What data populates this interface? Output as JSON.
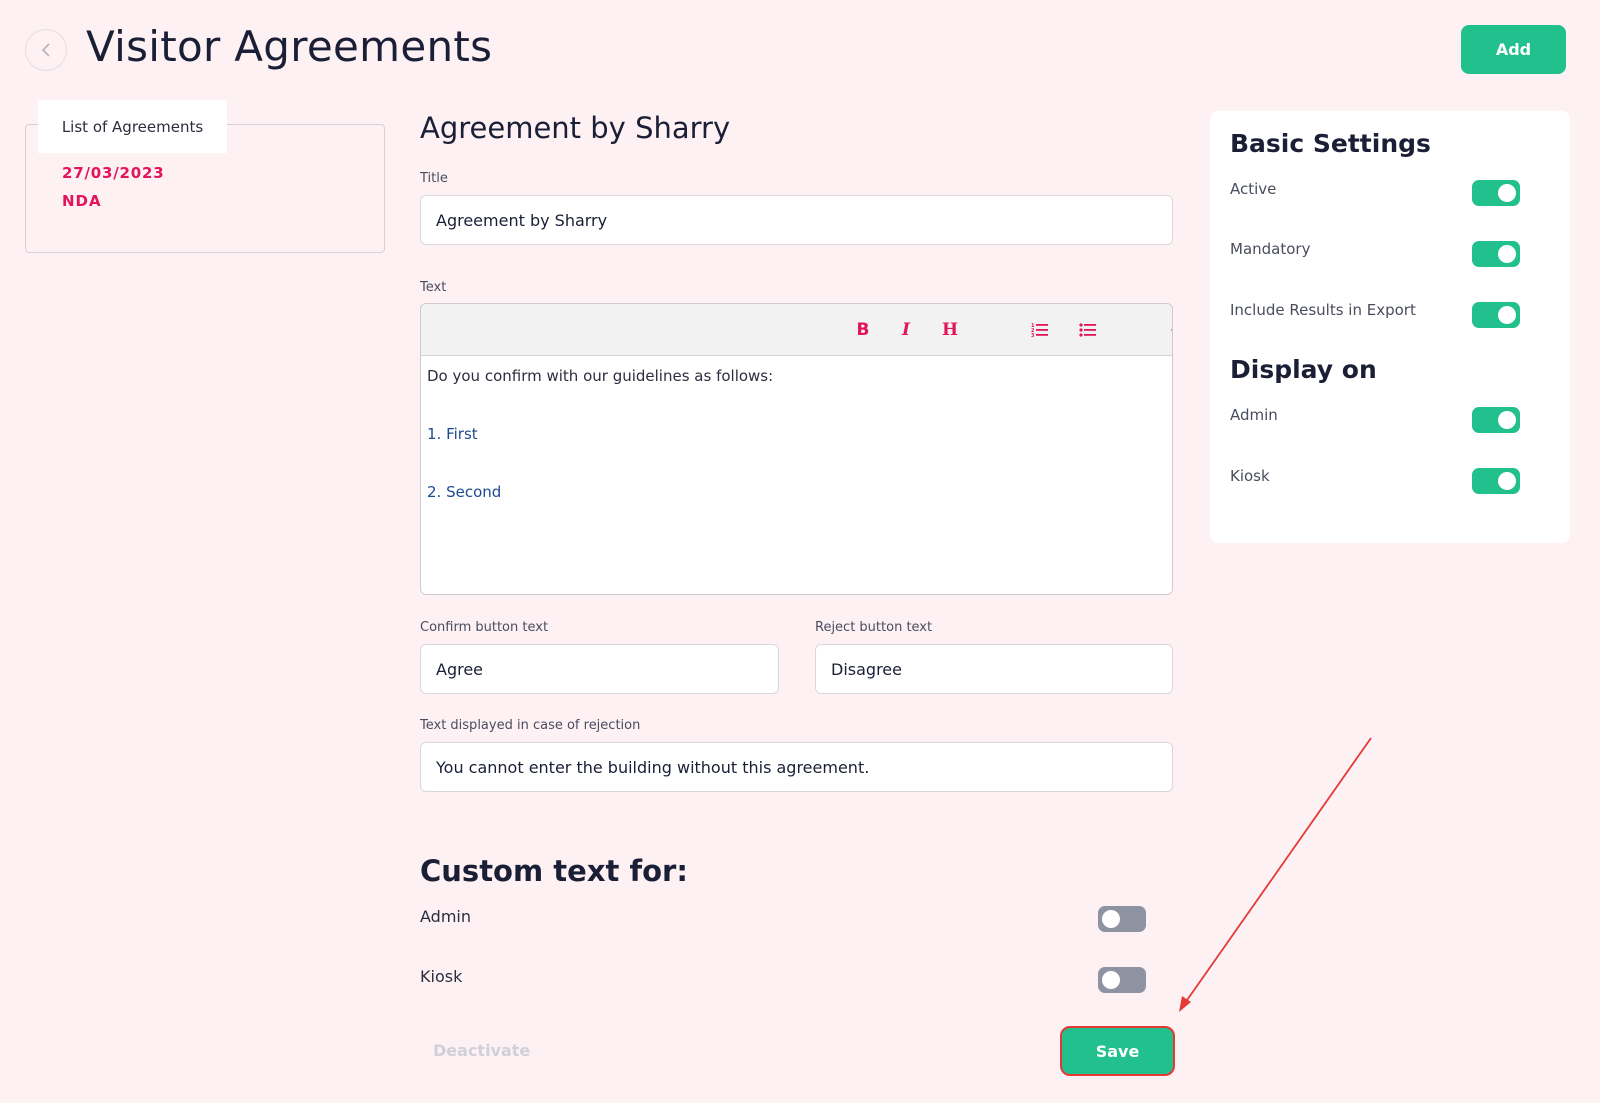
{
  "header": {
    "title": "Visitor Agreements",
    "add_label": "Add"
  },
  "sidebar": {
    "tab_label": "List of Agreements",
    "items": [
      {
        "date": "27/03/2023",
        "name": "NDA"
      }
    ]
  },
  "form": {
    "heading": "Agreement by Sharry",
    "title_label": "Title",
    "title_value": "Agreement by Sharry",
    "text_label": "Text",
    "toolbar": {
      "bold": "B",
      "italic": "I",
      "heading": "H"
    },
    "editor": {
      "intro": "Do you confirm with our guidelines as follows:",
      "items": [
        "1. First",
        "2. Second"
      ]
    },
    "confirm_label": "Confirm button text",
    "confirm_value": "Agree",
    "reject_label": "Reject button text",
    "reject_value": "Disagree",
    "rejection_label": "Text displayed in case of rejection",
    "rejection_value": "You cannot enter the building without this agreement."
  },
  "custom_text": {
    "heading": "Custom text for:",
    "rows": [
      {
        "label": "Admin",
        "enabled": false
      },
      {
        "label": "Kiosk",
        "enabled": false
      }
    ]
  },
  "actions": {
    "deactivate_label": "Deactivate",
    "save_label": "Save"
  },
  "settings": {
    "basic_heading": "Basic Settings",
    "basic": [
      {
        "label": "Active",
        "enabled": true
      },
      {
        "label": "Mandatory",
        "enabled": true
      },
      {
        "label": "Include Results in Export",
        "enabled": true
      }
    ],
    "display_heading": "Display on",
    "display": [
      {
        "label": "Admin",
        "enabled": true
      },
      {
        "label": "Kiosk",
        "enabled": true
      }
    ]
  },
  "icons": {
    "back": "chevron-left-icon",
    "ordered_list": "ordered-list-icon",
    "unordered_list": "unordered-list-icon",
    "preview": "eye-icon"
  },
  "colors": {
    "accent": "#21c08d",
    "brand_pink": "#e2145a",
    "background": "#fdf1f4",
    "annotation_red": "#e53935"
  }
}
